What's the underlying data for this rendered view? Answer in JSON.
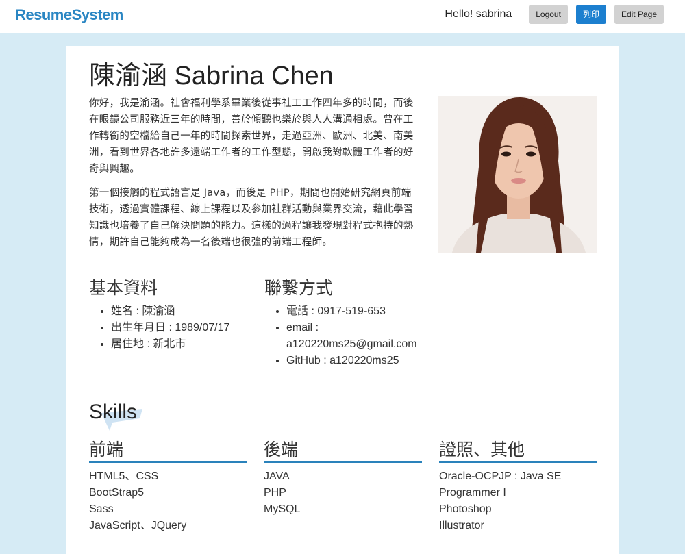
{
  "navbar": {
    "brand": "ResumeSystem",
    "greeting": "Hello! sabrina",
    "logout_label": "Logout",
    "print_label": "列印",
    "edit_label": "Edit Page"
  },
  "profile": {
    "name": "陳渝涵 Sabrina Chen",
    "intro": [
      "你好，我是渝涵。社會福利學系畢業後從事社工工作四年多的時間，而後在眼鏡公司服務近三年的時間，善於傾聽也樂於與人人溝通相處。曾在工作轉銜的空檔給自己一年的時間探索世界，走過亞洲、歐洲、北美、南美洲，看到世界各地許多遠端工作者的工作型態，開啟我對軟體工作者的好奇與興趣。",
      "第一個接觸的程式語言是 Java，而後是 PHP，期間也開始研究網頁前端技術，透過實體課程、線上課程以及參加社群活動與業界交流，藉此學習知識也培養了自己解決問題的能力。這樣的過程讓我發現對程式抱持的熱情，期許自己能夠成為一名後端也很強的前端工程師。"
    ]
  },
  "basic_info": {
    "title": "基本資料",
    "items": [
      "姓名 : 陳渝涵",
      "出生年月日 : 1989/07/17",
      "居住地 : 新北市"
    ]
  },
  "contact": {
    "title": "聯繫方式",
    "items": [
      "電話 : 0917-519-653",
      "email : a120220ms25@gmail.com",
      "GitHub : a120220ms25"
    ]
  },
  "skills": {
    "title": "Skills",
    "accent_color": "#2a82bb",
    "columns": [
      {
        "title": "前端",
        "items": [
          "HTML5、CSS",
          "BootStrap5",
          "Sass",
          "JavaScript、JQuery"
        ]
      },
      {
        "title": "後端",
        "items": [
          "JAVA",
          "PHP",
          "MySQL"
        ]
      },
      {
        "title": "證照、其他",
        "items": [
          "Oracle-OCPJP : Java SE Programmer I",
          "Photoshop",
          "Illustrator"
        ]
      }
    ]
  }
}
